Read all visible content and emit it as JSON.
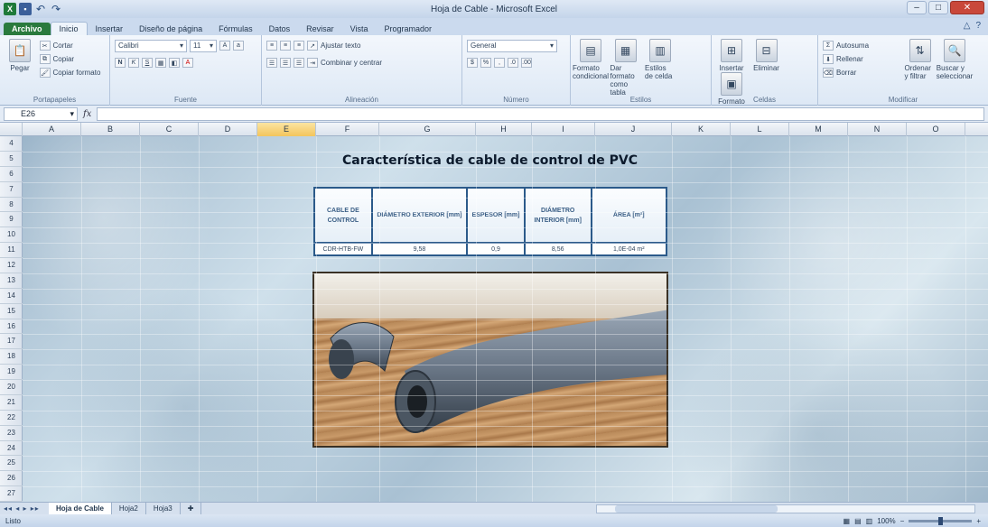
{
  "window": {
    "title": "Hoja de Cable - Microsoft Excel",
    "minimize_glyph": "–",
    "maximize_glyph": "□",
    "close_glyph": "✕"
  },
  "tabs": [
    "Archivo",
    "Inicio",
    "Insertar",
    "Diseño de página",
    "Fórmulas",
    "Datos",
    "Revisar",
    "Vista",
    "Programador"
  ],
  "ribbon": {
    "portapapeles": {
      "paste_label": "Pegar",
      "cut_label": "Cortar",
      "copy_label": "Copiar",
      "format_painter_label": "Copiar formato",
      "group_label": "Portapapeles"
    },
    "fuente": {
      "font_name": "Calibri",
      "font_size": "11",
      "bold": "N",
      "italic": "K",
      "underline": "S",
      "group_label": "Fuente"
    },
    "alineacion": {
      "wrap_label": "Ajustar texto",
      "merge_label": "Combinar y centrar",
      "group_label": "Alineación"
    },
    "numero": {
      "format_value": "General",
      "group_label": "Número"
    },
    "estilos": {
      "conditional_label": "Formato condicional",
      "table_label": "Dar formato como tabla",
      "cell_styles_label": "Estilos de celda",
      "group_label": "Estilos"
    },
    "celdas": {
      "insert_label": "Insertar",
      "delete_label": "Eliminar",
      "format_label": "Formato",
      "group_label": "Celdas"
    },
    "modificar": {
      "autosum_label": "Autosuma",
      "fill_label": "Rellenar",
      "clear_label": "Borrar",
      "sort_label": "Ordenar y filtrar",
      "find_label": "Buscar y seleccionar",
      "group_label": "Modificar"
    }
  },
  "formula_bar": {
    "name_box": "E26",
    "fx": "fx",
    "content": ""
  },
  "columns": [
    "A",
    "B",
    "C",
    "D",
    "E",
    "F",
    "G",
    "H",
    "I",
    "J",
    "K",
    "L",
    "M",
    "N",
    "O"
  ],
  "selected_column": "E",
  "rows": [
    "4",
    "5",
    "6",
    "7",
    "8",
    "9",
    "10",
    "11",
    "12",
    "13",
    "14",
    "15",
    "16",
    "17",
    "18",
    "19",
    "20",
    "21",
    "22",
    "23",
    "24",
    "25",
    "26",
    "27"
  ],
  "document": {
    "title": "Característica de cable de control de PVC",
    "table_headers": [
      "CABLE DE CONTROL",
      "DIÁMETRO EXTERIOR [mm]",
      "ESPESOR [mm]",
      "DIÁMETRO INTERIOR [mm]",
      "ÁREA [m²]"
    ],
    "table_row": [
      "CDR-HTB-FW",
      "9,58",
      "0,9",
      "8,56",
      "1,0E-04 m²"
    ]
  },
  "sheet_tabs": [
    "Hoja de Cable",
    "Hoja2",
    "Hoja3"
  ],
  "status": {
    "ready": "Listo",
    "zoom": "100%"
  }
}
